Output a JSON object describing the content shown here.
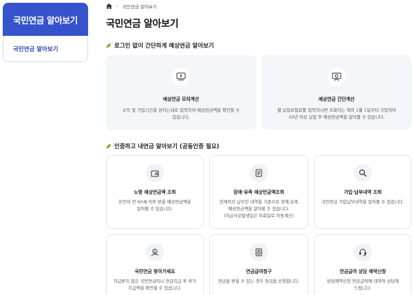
{
  "sidebar": {
    "header": "국민연금 알아보기",
    "items": [
      {
        "label": "국민연금 알아보기"
      }
    ]
  },
  "breadcrumb": {
    "home_icon": "home-icon",
    "current": "국민연금 알아보기"
  },
  "page": {
    "title": "국민연금 알아보기"
  },
  "sections": [
    {
      "title": "로그인 없이 간단하게 예상연금 알아보기",
      "cards": [
        {
          "icon": "monitor-play-icon",
          "title": "예상연금 모의계산",
          "desc": [
            "소득 및 가입기간을 원하는대로 입력하여 예상연금액을 확인할 수",
            "있습니다."
          ]
        },
        {
          "icon": "presentation-icon",
          "title": "예상연금 간단계산",
          "desc": [
            "월 납입보험료를 입력하시면 조회하는 해의 1월 1일부터 가입하여",
            "10년 이상 납입 후 예상연금액을 알아볼 수 있습니다."
          ]
        }
      ]
    },
    {
      "title": "인증하고 내연금 알아보기 (공동인증 필요)",
      "cards": [
        {
          "icon": "wallet-icon",
          "title": "노령 예상연금액 조회",
          "desc": [
            "본인이 만 60세 이후 받을 예상연금액을",
            "알아볼 수 있습니다."
          ]
        },
        {
          "icon": "document-icon",
          "title": "장애·유족 예상연금액조회",
          "desc": [
            "현재까지 납부한 내역을 기준으로 장애,유족",
            "예상연금액을 알아볼 수 있습니다.",
            "(지급사유발생일은 조회일로 자동계산)"
          ]
        },
        {
          "icon": "search-doc-icon",
          "title": "가입·납부내역 조회",
          "desc": [
            "국민연금 가입납부내역을 알아볼 수 있습니다."
          ]
        },
        {
          "icon": "money-hand-icon",
          "title": "국민연금 찾아가세요",
          "desc": [
            "지급받지 않은 국민연금이나 연금지급 후 추가",
            "지급액을 확인할 수 있습니다."
          ]
        },
        {
          "icon": "coin-doc-icon",
          "title": "연금급여청구",
          "desc": [
            "연금을 받을 수 있는 경우 연금을 신청합니다."
          ]
        },
        {
          "icon": "headset-icon",
          "title": "연금급여 상담 예약신청",
          "desc": [
            "상담예약신청 연금급여에 대하여 상담해",
            "드립니다."
          ]
        }
      ]
    }
  ],
  "colors": {
    "brand": "#3553cc",
    "card_bg": "#f4f6fa",
    "leaf": "#8bc34a"
  }
}
